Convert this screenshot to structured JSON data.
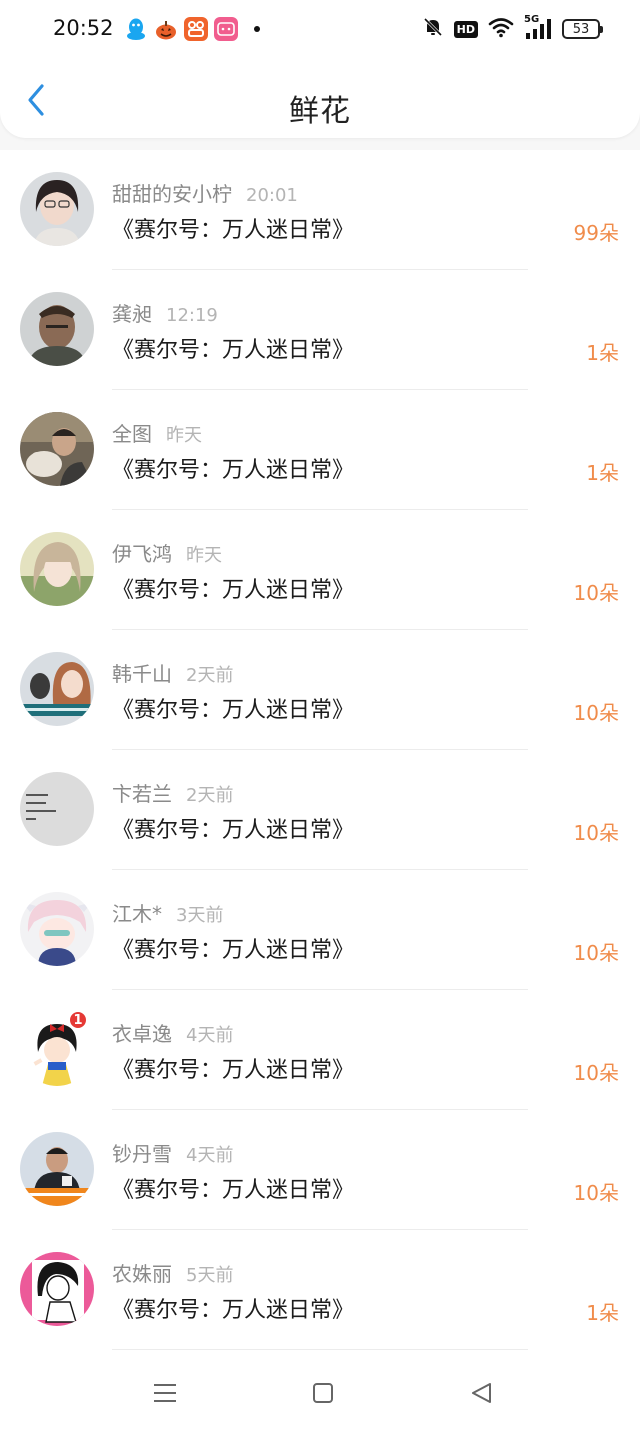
{
  "status_bar": {
    "time": "20:52",
    "hd_label": "HD",
    "network_label": "5G",
    "battery_level": "53"
  },
  "header": {
    "title": "鲜花",
    "back_icon": "chevron-left-icon"
  },
  "colors": {
    "accent": "#2e8fe0",
    "count_orange": "#f08c4b"
  },
  "flowers": [
    {
      "name": "甜甜的安小柠",
      "time": "20:01",
      "book": "《赛尔号：万人迷日常》",
      "count": "99朵"
    },
    {
      "name": "龚昶",
      "time": "12:19",
      "book": "《赛尔号：万人迷日常》",
      "count": "1朵"
    },
    {
      "name": "全图",
      "time": "昨天",
      "book": "《赛尔号：万人迷日常》",
      "count": "1朵"
    },
    {
      "name": "伊飞鸿",
      "time": "昨天",
      "book": "《赛尔号：万人迷日常》",
      "count": "10朵"
    },
    {
      "name": "韩千山",
      "time": "2天前",
      "book": "《赛尔号：万人迷日常》",
      "count": "10朵"
    },
    {
      "name": "卞若兰",
      "time": "2天前",
      "book": "《赛尔号：万人迷日常》",
      "count": "10朵"
    },
    {
      "name": "江木*",
      "time": "3天前",
      "book": "《赛尔号：万人迷日常》",
      "count": "10朵"
    },
    {
      "name": "衣卓逸",
      "time": "4天前",
      "book": "《赛尔号：万人迷日常》",
      "count": "10朵",
      "badge": "1"
    },
    {
      "name": "钞丹雪",
      "time": "4天前",
      "book": "《赛尔号：万人迷日常》",
      "count": "10朵"
    },
    {
      "name": "农姝丽",
      "time": "5天前",
      "book": "《赛尔号：万人迷日常》",
      "count": "1朵"
    }
  ]
}
